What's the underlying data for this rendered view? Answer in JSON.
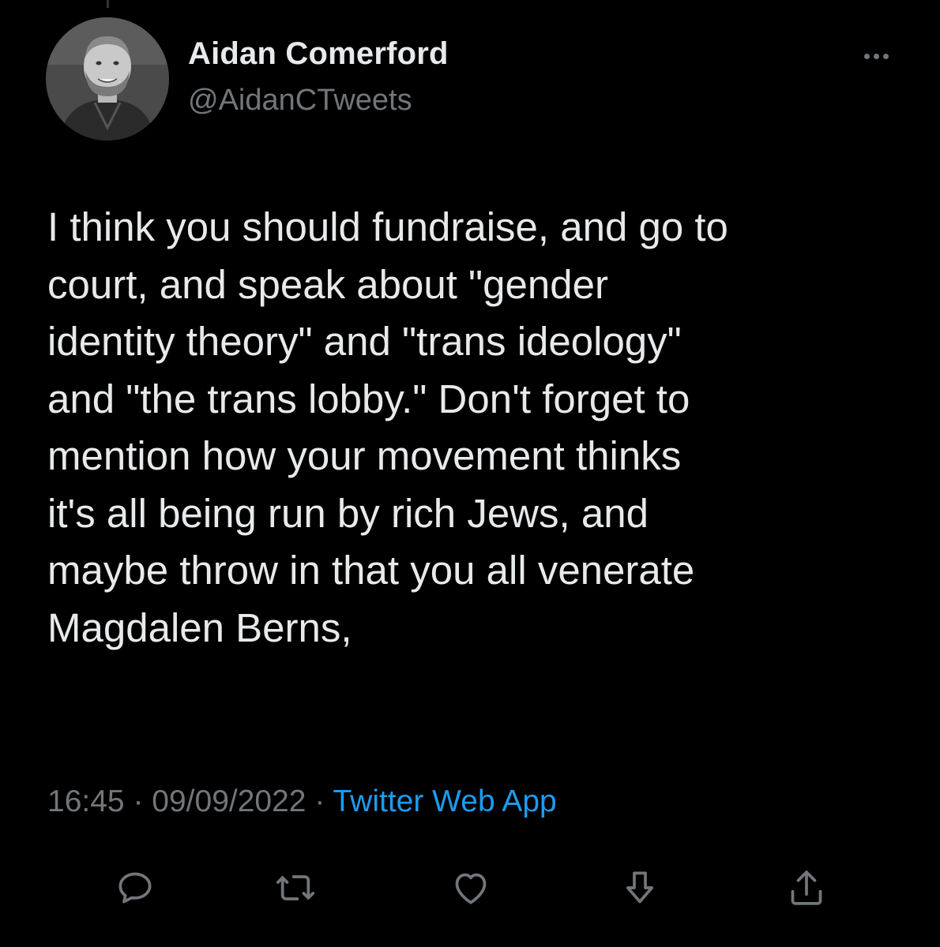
{
  "tweet": {
    "author_name": "Aidan Comerford",
    "author_handle": "@AidanCTweets",
    "text": "I think you should fundraise, and go to\ncourt, and speak about \"gender\nidentity theory\" and \"trans ideology\"\nand \"the trans lobby.\" Don't forget to\nmention how your movement thinks\nit's all being run by rich Jews, and\nmaybe throw in that you all venerate\nMagdalen Berns,",
    "time": "16:45",
    "date": "09/09/2022",
    "separator": "·",
    "source": "Twitter Web App"
  },
  "actions": [
    {
      "icon": "reply-icon"
    },
    {
      "icon": "retweet-icon"
    },
    {
      "icon": "like-icon"
    },
    {
      "icon": "bookmark-icon"
    },
    {
      "icon": "share-icon"
    }
  ],
  "colors": {
    "background": "#000000",
    "text_primary": "#e7e9ea",
    "text_secondary": "#71767b",
    "link_accent": "#1d9bf0"
  }
}
